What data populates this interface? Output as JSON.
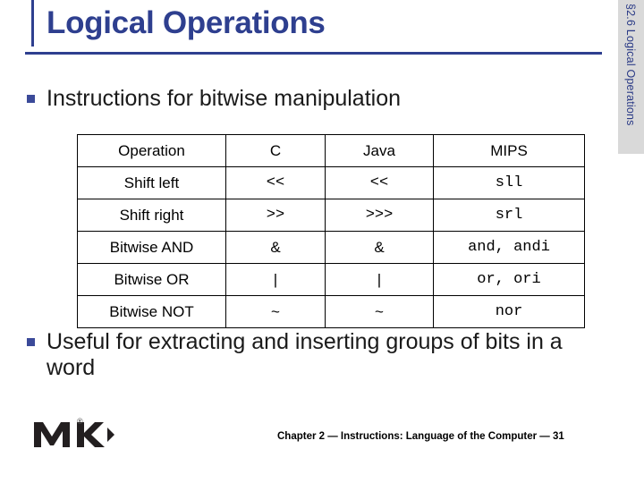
{
  "slide": {
    "title": "Logical Operations",
    "sidebar_label": "§2.6 Logical Operations",
    "bullets": [
      "Instructions for bitwise manipulation",
      "Useful for extracting and inserting groups of bits in a word"
    ],
    "footer": "Chapter 2 — Instructions: Language of the Computer — 31",
    "logo_registered_mark": "®",
    "accent_color": "#2e3f8f",
    "sidebar_bg": "#d9d9d9"
  },
  "table": {
    "headers": [
      "Operation",
      "C",
      "Java",
      "MIPS"
    ],
    "rows": [
      {
        "operation": "Shift left",
        "c": "<<",
        "java": "<<",
        "mips": "sll"
      },
      {
        "operation": "Shift right",
        "c": ">>",
        "java": ">>>",
        "mips": "srl"
      },
      {
        "operation": "Bitwise AND",
        "c": "&",
        "java": "&",
        "mips": "and, andi"
      },
      {
        "operation": "Bitwise OR",
        "c": "|",
        "java": "|",
        "mips": "or, ori"
      },
      {
        "operation": "Bitwise NOT",
        "c": "~",
        "java": "~",
        "mips": "nor"
      }
    ]
  }
}
